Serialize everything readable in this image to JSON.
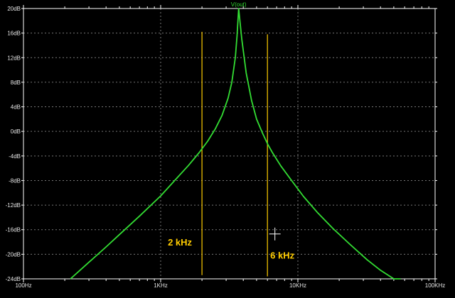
{
  "chart_data": {
    "type": "line",
    "title": "V(out)",
    "x_scale": "log",
    "x_unit": "Hz",
    "xlim": [
      100,
      100000
    ],
    "ylim": [
      -24,
      20
    ],
    "y_unit": "dB",
    "grid": true,
    "x_ticks": [
      {
        "value": 100,
        "label": "100Hz"
      },
      {
        "value": 1000,
        "label": "1KHz"
      },
      {
        "value": 10000,
        "label": "10KHz"
      },
      {
        "value": 100000,
        "label": "100KHz"
      }
    ],
    "y_ticks": [
      {
        "value": 20,
        "label": "20dB"
      },
      {
        "value": 16,
        "label": "16dB"
      },
      {
        "value": 12,
        "label": "12dB"
      },
      {
        "value": 8,
        "label": "8dB"
      },
      {
        "value": 4,
        "label": "4dB"
      },
      {
        "value": 0,
        "label": "0dB"
      },
      {
        "value": -4,
        "label": "-4dB"
      },
      {
        "value": -8,
        "label": "-8dB"
      },
      {
        "value": -12,
        "label": "-12dB"
      },
      {
        "value": -16,
        "label": "-16dB"
      },
      {
        "value": -20,
        "label": "-20dB"
      },
      {
        "value": -24,
        "label": "-24dB"
      }
    ],
    "series": [
      {
        "name": "V(out)",
        "color": "#33dd33",
        "x": [
          220,
          300,
          400,
          500,
          700,
          1000,
          1300,
          1600,
          1900,
          2200,
          2500,
          2800,
          3100,
          3300,
          3500,
          3600,
          3700,
          3900,
          4200,
          4600,
          5000,
          5500,
          6000,
          6500,
          7500,
          9000,
          11000,
          14000,
          18000,
          24000,
          32000,
          40000,
          50000,
          56000
        ],
        "y": [
          -24,
          -21.3,
          -18.8,
          -16.8,
          -13.8,
          -10.5,
          -7.7,
          -5.5,
          -3.5,
          -1.6,
          0.4,
          2.6,
          5.4,
          8.0,
          12.0,
          15.5,
          20.0,
          15.0,
          9.5,
          5.0,
          2.0,
          -0.2,
          -2.0,
          -3.4,
          -5.6,
          -8.0,
          -10.6,
          -13.3,
          -15.8,
          -18.4,
          -20.9,
          -22.6,
          -24.0,
          -24.0
        ]
      }
    ],
    "markers": [
      {
        "x": 2000,
        "y_top": 16.2,
        "y_bottom": -23.4,
        "label": "2 kHz",
        "color": "#ffcc00"
      },
      {
        "x": 6000,
        "y_top": 15.8,
        "y_bottom": -23.6,
        "label": "6 kHz",
        "color": "#ffcc00"
      }
    ],
    "cursor": {
      "x": 6800,
      "y": -16.7,
      "color": "#ffffff"
    },
    "colors": {
      "background": "#000000",
      "axis": "#ffffff",
      "grid": "#777777",
      "labels": "#e6e6e6"
    }
  }
}
